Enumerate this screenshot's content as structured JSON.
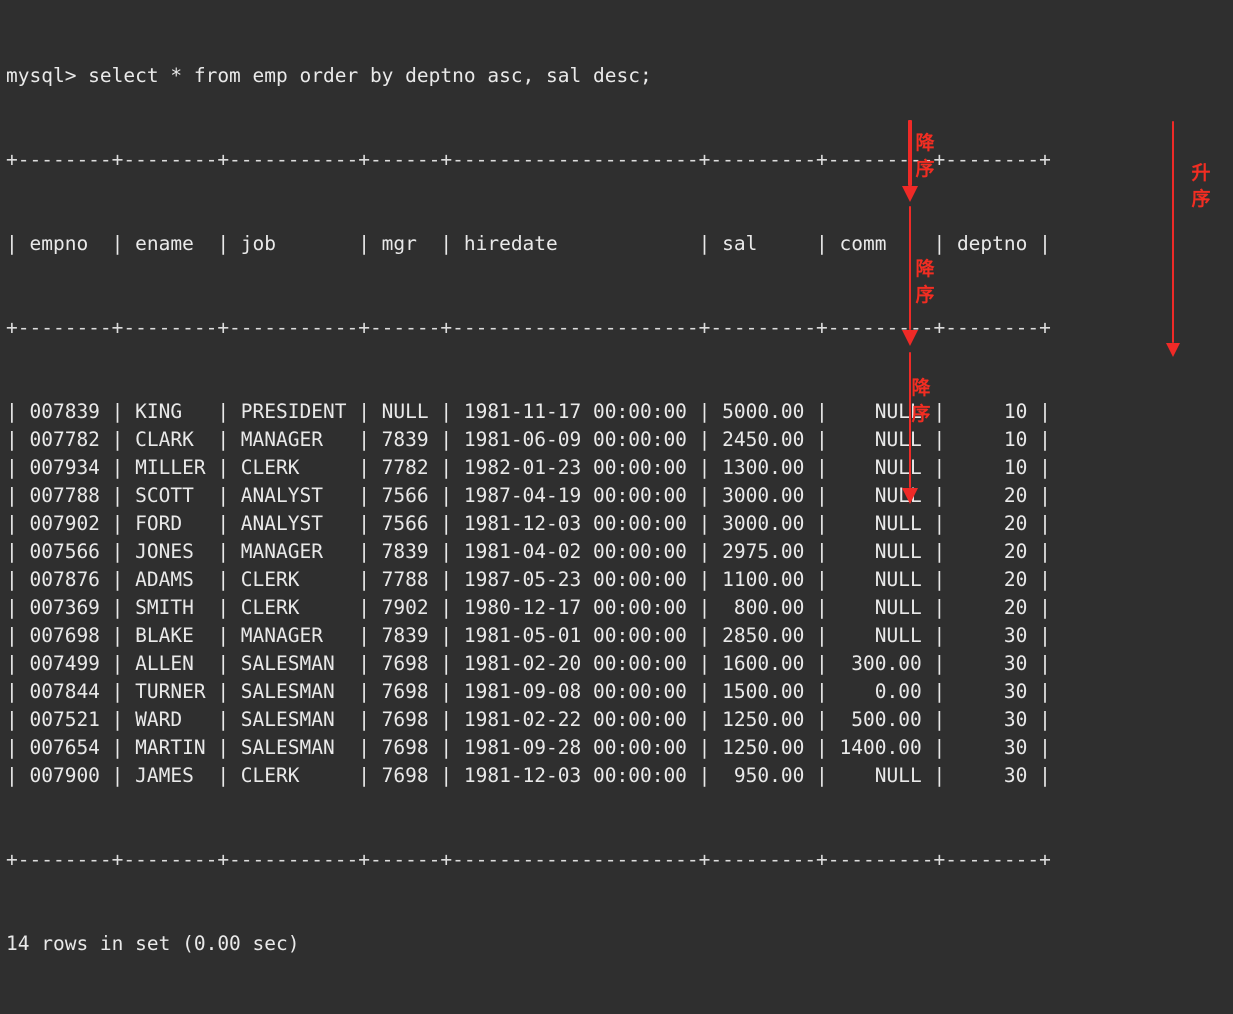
{
  "terminal": {
    "background_color": "#2f2f2f",
    "foreground_color": "#e9e9e9",
    "annotation_color": "#ef2a27",
    "prompt": "mysql> ",
    "command": "select * from emp order by deptno asc, sal desc;",
    "prompt_line": "mysql> select * from emp order by deptno asc, sal desc;",
    "separator_line": "+--------+--------+-----------+------+---------------------+---------+---------+--------+",
    "header_line": "| empno  | ename  | job       | mgr  | hiredate            | sal     | comm    | deptno |",
    "footer": "14 rows in set (0.00 sec)"
  },
  "table": {
    "columns": [
      "empno",
      "ename",
      "job",
      "mgr",
      "hiredate",
      "sal",
      "comm",
      "deptno"
    ],
    "row_count": 14,
    "rows": [
      {
        "empno": "007839",
        "ename": "KING",
        "job": "PRESIDENT",
        "mgr": "NULL",
        "hiredate": "1981-11-17 00:00:00",
        "sal": "5000.00",
        "comm": "NULL",
        "deptno": "10"
      },
      {
        "empno": "007782",
        "ename": "CLARK",
        "job": "MANAGER",
        "mgr": "7839",
        "hiredate": "1981-06-09 00:00:00",
        "sal": "2450.00",
        "comm": "NULL",
        "deptno": "10"
      },
      {
        "empno": "007934",
        "ename": "MILLER",
        "job": "CLERK",
        "mgr": "7782",
        "hiredate": "1982-01-23 00:00:00",
        "sal": "1300.00",
        "comm": "NULL",
        "deptno": "10"
      },
      {
        "empno": "007788",
        "ename": "SCOTT",
        "job": "ANALYST",
        "mgr": "7566",
        "hiredate": "1987-04-19 00:00:00",
        "sal": "3000.00",
        "comm": "NULL",
        "deptno": "20"
      },
      {
        "empno": "007902",
        "ename": "FORD",
        "job": "ANALYST",
        "mgr": "7566",
        "hiredate": "1981-12-03 00:00:00",
        "sal": "3000.00",
        "comm": "NULL",
        "deptno": "20"
      },
      {
        "empno": "007566",
        "ename": "JONES",
        "job": "MANAGER",
        "mgr": "7839",
        "hiredate": "1981-04-02 00:00:00",
        "sal": "2975.00",
        "comm": "NULL",
        "deptno": "20"
      },
      {
        "empno": "007876",
        "ename": "ADAMS",
        "job": "CLERK",
        "mgr": "7788",
        "hiredate": "1987-05-23 00:00:00",
        "sal": "1100.00",
        "comm": "NULL",
        "deptno": "20"
      },
      {
        "empno": "007369",
        "ename": "SMITH",
        "job": "CLERK",
        "mgr": "7902",
        "hiredate": "1980-12-17 00:00:00",
        "sal": "800.00",
        "comm": "NULL",
        "deptno": "20"
      },
      {
        "empno": "007698",
        "ename": "BLAKE",
        "job": "MANAGER",
        "mgr": "7839",
        "hiredate": "1981-05-01 00:00:00",
        "sal": "2850.00",
        "comm": "NULL",
        "deptno": "30"
      },
      {
        "empno": "007499",
        "ename": "ALLEN",
        "job": "SALESMAN",
        "mgr": "7698",
        "hiredate": "1981-02-20 00:00:00",
        "sal": "1600.00",
        "comm": "300.00",
        "deptno": "30"
      },
      {
        "empno": "007844",
        "ename": "TURNER",
        "job": "SALESMAN",
        "mgr": "7698",
        "hiredate": "1981-09-08 00:00:00",
        "sal": "1500.00",
        "comm": "0.00",
        "deptno": "30"
      },
      {
        "empno": "007521",
        "ename": "WARD",
        "job": "SALESMAN",
        "mgr": "7698",
        "hiredate": "1981-02-22 00:00:00",
        "sal": "1250.00",
        "comm": "500.00",
        "deptno": "30"
      },
      {
        "empno": "007654",
        "ename": "MARTIN",
        "job": "SALESMAN",
        "mgr": "7698",
        "hiredate": "1981-09-28 00:00:00",
        "sal": "1250.00",
        "comm": "1400.00",
        "deptno": "30"
      },
      {
        "empno": "007900",
        "ename": "JAMES",
        "job": "CLERK",
        "mgr": "7698",
        "hiredate": "1981-12-03 00:00:00",
        "sal": "950.00",
        "comm": "NULL",
        "deptno": "30"
      }
    ]
  },
  "annotations": [
    {
      "id": "desc-dept10",
      "label": "降\n序",
      "meaning": "descending"
    },
    {
      "id": "desc-dept20",
      "label": "降\n序",
      "meaning": "descending"
    },
    {
      "id": "desc-dept30",
      "label": "降\n序",
      "meaning": "descending"
    },
    {
      "id": "asc-deptno",
      "label": "升\n序",
      "meaning": "ascending"
    }
  ]
}
